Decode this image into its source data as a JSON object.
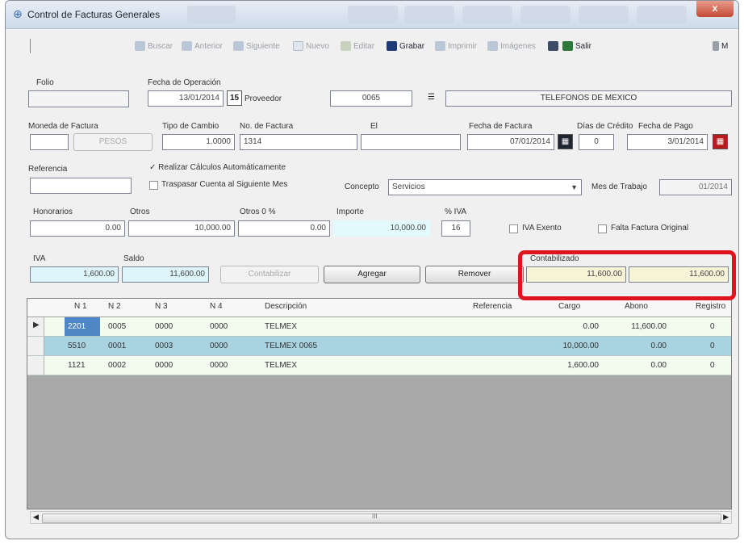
{
  "window": {
    "title": "Control de Facturas Generales",
    "close_label": "x"
  },
  "toolbar": {
    "buscar": "Buscar",
    "anterior": "Anterior",
    "siguiente": "Siguiente",
    "nuevo": "Nuevo",
    "editar": "Editar",
    "grabar": "Grabar",
    "imprimir": "Imprimir",
    "imagenes": "Imágenes",
    "salir": "Salir",
    "more": "M"
  },
  "form": {
    "folio_label": "Folio",
    "folio_value": "",
    "fecha_operacion_label": "Fecha de Operación",
    "fecha_operacion_value": "13/01/2014",
    "proveedor_label": "Proveedor",
    "proveedor_value": "0065",
    "proveedor_nombre": "TELEFONOS DE MEXICO",
    "moneda_label": "Moneda de Factura",
    "moneda_code": "",
    "moneda_value": "PESOS",
    "tipo_cambio_label": "Tipo de Cambio",
    "tipo_cambio_value": "1.0000",
    "no_factura_label": "No. de Factura",
    "no_factura_value": "1314",
    "el_label": "El",
    "el_value": "",
    "fecha_factura_label": "Fecha de Factura",
    "fecha_factura_value": "07/01/2014",
    "dias_credito_label": "Días de Crédito",
    "dias_credito_value": "0",
    "fecha_pago_label": "Fecha de Pago",
    "fecha_pago_value": "3/01/2014",
    "referencia_label": "Referencia",
    "referencia_value": "",
    "realizar_calculos_label": "Realizar Cálculos Automáticamente",
    "traspasar_label": "Traspasar Cuenta al Siguiente Mes",
    "concepto_label": "Concepto",
    "concepto_value": "Servicios",
    "mes_trabajo_label": "Mes de Trabajo",
    "mes_trabajo_value": "01/2014",
    "honorarios_label": "Honorarios",
    "honorarios_value": "0.00",
    "otros_label": "Otros",
    "otros_value": "10,000.00",
    "otros0_label": "Otros 0 %",
    "otros0_value": "0.00",
    "importe_label": "Importe",
    "importe_value": "10,000.00",
    "pct_iva_label": "% IVA",
    "pct_iva_value": "16",
    "iva_exento_label": "IVA Exento",
    "falta_factura_label": "Falta Factura Original",
    "iva_label": "IVA",
    "iva_value": "1,600.00",
    "saldo_label": "Saldo",
    "saldo_value": "11,600.00",
    "contabilizar_label": "Contabilizar",
    "agregar_label": "Agregar",
    "remover_label": "Remover",
    "contabilizado_label": "Contabilizado",
    "total_cargo": "11,600.00",
    "total_abono": "11,600.00"
  },
  "grid": {
    "columns": [
      "N 1",
      "N 2",
      "N 3",
      "N 4",
      "Descripción",
      "Referencia",
      "Cargo",
      "Abono",
      "Registro"
    ],
    "rows": [
      {
        "n1": "2201",
        "n2": "0005",
        "n3": "0000",
        "n4": "0000",
        "desc": "TELMEX",
        "ref": "",
        "cargo": "0.00",
        "abono": "11,600.00",
        "reg": "0"
      },
      {
        "n1": "5510",
        "n2": "0001",
        "n3": "0003",
        "n4": "0000",
        "desc": "TELMEX 0065",
        "ref": "",
        "cargo": "10,000.00",
        "abono": "0.00",
        "reg": "0"
      },
      {
        "n1": "1121",
        "n2": "0002",
        "n3": "0000",
        "n4": "0000",
        "desc": "TELMEX",
        "ref": "",
        "cargo": "1,600.00",
        "abono": "0.00",
        "reg": "0"
      }
    ],
    "scroll_mid": "III"
  }
}
